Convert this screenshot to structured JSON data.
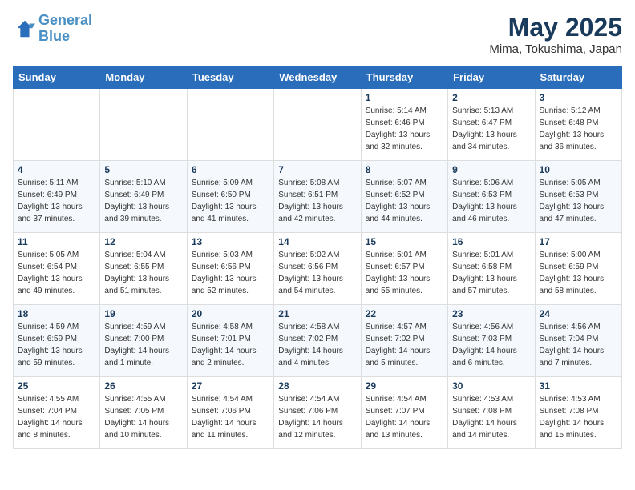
{
  "logo": {
    "line1": "General",
    "line2": "Blue"
  },
  "title": "May 2025",
  "location": "Mima, Tokushima, Japan",
  "days_header": [
    "Sunday",
    "Monday",
    "Tuesday",
    "Wednesday",
    "Thursday",
    "Friday",
    "Saturday"
  ],
  "weeks": [
    [
      {
        "num": "",
        "detail": ""
      },
      {
        "num": "",
        "detail": ""
      },
      {
        "num": "",
        "detail": ""
      },
      {
        "num": "",
        "detail": ""
      },
      {
        "num": "1",
        "detail": "Sunrise: 5:14 AM\nSunset: 6:46 PM\nDaylight: 13 hours\nand 32 minutes."
      },
      {
        "num": "2",
        "detail": "Sunrise: 5:13 AM\nSunset: 6:47 PM\nDaylight: 13 hours\nand 34 minutes."
      },
      {
        "num": "3",
        "detail": "Sunrise: 5:12 AM\nSunset: 6:48 PM\nDaylight: 13 hours\nand 36 minutes."
      }
    ],
    [
      {
        "num": "4",
        "detail": "Sunrise: 5:11 AM\nSunset: 6:49 PM\nDaylight: 13 hours\nand 37 minutes."
      },
      {
        "num": "5",
        "detail": "Sunrise: 5:10 AM\nSunset: 6:49 PM\nDaylight: 13 hours\nand 39 minutes."
      },
      {
        "num": "6",
        "detail": "Sunrise: 5:09 AM\nSunset: 6:50 PM\nDaylight: 13 hours\nand 41 minutes."
      },
      {
        "num": "7",
        "detail": "Sunrise: 5:08 AM\nSunset: 6:51 PM\nDaylight: 13 hours\nand 42 minutes."
      },
      {
        "num": "8",
        "detail": "Sunrise: 5:07 AM\nSunset: 6:52 PM\nDaylight: 13 hours\nand 44 minutes."
      },
      {
        "num": "9",
        "detail": "Sunrise: 5:06 AM\nSunset: 6:53 PM\nDaylight: 13 hours\nand 46 minutes."
      },
      {
        "num": "10",
        "detail": "Sunrise: 5:05 AM\nSunset: 6:53 PM\nDaylight: 13 hours\nand 47 minutes."
      }
    ],
    [
      {
        "num": "11",
        "detail": "Sunrise: 5:05 AM\nSunset: 6:54 PM\nDaylight: 13 hours\nand 49 minutes."
      },
      {
        "num": "12",
        "detail": "Sunrise: 5:04 AM\nSunset: 6:55 PM\nDaylight: 13 hours\nand 51 minutes."
      },
      {
        "num": "13",
        "detail": "Sunrise: 5:03 AM\nSunset: 6:56 PM\nDaylight: 13 hours\nand 52 minutes."
      },
      {
        "num": "14",
        "detail": "Sunrise: 5:02 AM\nSunset: 6:56 PM\nDaylight: 13 hours\nand 54 minutes."
      },
      {
        "num": "15",
        "detail": "Sunrise: 5:01 AM\nSunset: 6:57 PM\nDaylight: 13 hours\nand 55 minutes."
      },
      {
        "num": "16",
        "detail": "Sunrise: 5:01 AM\nSunset: 6:58 PM\nDaylight: 13 hours\nand 57 minutes."
      },
      {
        "num": "17",
        "detail": "Sunrise: 5:00 AM\nSunset: 6:59 PM\nDaylight: 13 hours\nand 58 minutes."
      }
    ],
    [
      {
        "num": "18",
        "detail": "Sunrise: 4:59 AM\nSunset: 6:59 PM\nDaylight: 13 hours\nand 59 minutes."
      },
      {
        "num": "19",
        "detail": "Sunrise: 4:59 AM\nSunset: 7:00 PM\nDaylight: 14 hours\nand 1 minute."
      },
      {
        "num": "20",
        "detail": "Sunrise: 4:58 AM\nSunset: 7:01 PM\nDaylight: 14 hours\nand 2 minutes."
      },
      {
        "num": "21",
        "detail": "Sunrise: 4:58 AM\nSunset: 7:02 PM\nDaylight: 14 hours\nand 4 minutes."
      },
      {
        "num": "22",
        "detail": "Sunrise: 4:57 AM\nSunset: 7:02 PM\nDaylight: 14 hours\nand 5 minutes."
      },
      {
        "num": "23",
        "detail": "Sunrise: 4:56 AM\nSunset: 7:03 PM\nDaylight: 14 hours\nand 6 minutes."
      },
      {
        "num": "24",
        "detail": "Sunrise: 4:56 AM\nSunset: 7:04 PM\nDaylight: 14 hours\nand 7 minutes."
      }
    ],
    [
      {
        "num": "25",
        "detail": "Sunrise: 4:55 AM\nSunset: 7:04 PM\nDaylight: 14 hours\nand 8 minutes."
      },
      {
        "num": "26",
        "detail": "Sunrise: 4:55 AM\nSunset: 7:05 PM\nDaylight: 14 hours\nand 10 minutes."
      },
      {
        "num": "27",
        "detail": "Sunrise: 4:54 AM\nSunset: 7:06 PM\nDaylight: 14 hours\nand 11 minutes."
      },
      {
        "num": "28",
        "detail": "Sunrise: 4:54 AM\nSunset: 7:06 PM\nDaylight: 14 hours\nand 12 minutes."
      },
      {
        "num": "29",
        "detail": "Sunrise: 4:54 AM\nSunset: 7:07 PM\nDaylight: 14 hours\nand 13 minutes."
      },
      {
        "num": "30",
        "detail": "Sunrise: 4:53 AM\nSunset: 7:08 PM\nDaylight: 14 hours\nand 14 minutes."
      },
      {
        "num": "31",
        "detail": "Sunrise: 4:53 AM\nSunset: 7:08 PM\nDaylight: 14 hours\nand 15 minutes."
      }
    ]
  ]
}
